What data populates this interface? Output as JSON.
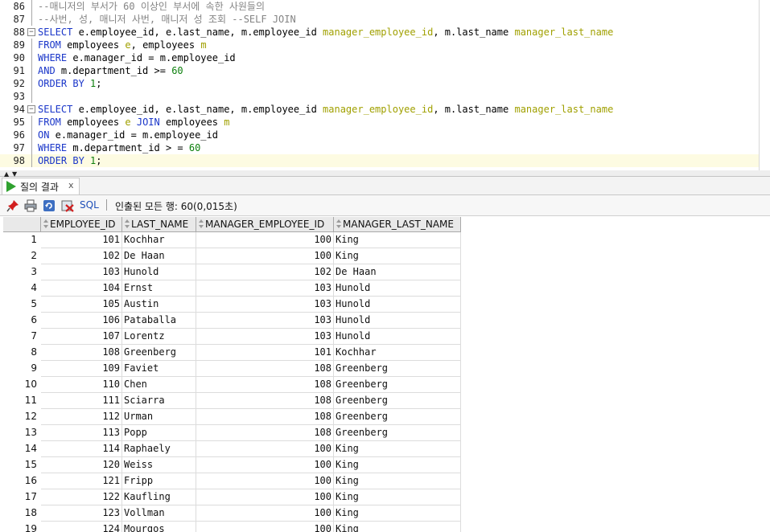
{
  "editor": {
    "lines": [
      {
        "num": "86",
        "tokens": [
          [
            "c",
            "--매니저의 부서가 60 이상인 부서에 속한 사원들의"
          ]
        ]
      },
      {
        "num": "87",
        "tokens": [
          [
            "c",
            "--사번, 성, 매니저 사번, 매니저 성 조회 --SELF JOIN"
          ]
        ]
      },
      {
        "num": "88",
        "tokens": [
          [
            "k",
            "SELECT"
          ],
          [
            "t",
            " e.employee_id, e.last_name, m.employee_id "
          ],
          [
            "a",
            "manager_employee_id"
          ],
          [
            "t",
            ", m.last_name "
          ],
          [
            "a",
            "manager_last_name"
          ]
        ]
      },
      {
        "num": "89",
        "tokens": [
          [
            "k",
            "FROM"
          ],
          [
            "t",
            " employees "
          ],
          [
            "a",
            "e"
          ],
          [
            "t",
            ", employees "
          ],
          [
            "a",
            "m"
          ]
        ]
      },
      {
        "num": "90",
        "tokens": [
          [
            "k",
            "WHERE"
          ],
          [
            "t",
            " e.manager_id = m.employee_id"
          ]
        ]
      },
      {
        "num": "91",
        "tokens": [
          [
            "k",
            "AND"
          ],
          [
            "t",
            " m.department_id >= "
          ],
          [
            "n",
            "60"
          ]
        ]
      },
      {
        "num": "92",
        "tokens": [
          [
            "k",
            "ORDER BY"
          ],
          [
            "t",
            " "
          ],
          [
            "n",
            "1"
          ],
          [
            "t",
            ";"
          ]
        ]
      },
      {
        "num": "93",
        "tokens": []
      },
      {
        "num": "94",
        "tokens": [
          [
            "k",
            "SELECT"
          ],
          [
            "t",
            " e.employee_id, e.last_name, m.employee_id "
          ],
          [
            "a",
            "manager_employee_id"
          ],
          [
            "t",
            ", m.last_name "
          ],
          [
            "a",
            "manager_last_name"
          ]
        ]
      },
      {
        "num": "95",
        "tokens": [
          [
            "k",
            "FROM"
          ],
          [
            "t",
            " employees "
          ],
          [
            "a",
            "e"
          ],
          [
            "t",
            " "
          ],
          [
            "k",
            "JOIN"
          ],
          [
            "t",
            " employees "
          ],
          [
            "a",
            "m"
          ]
        ]
      },
      {
        "num": "96",
        "tokens": [
          [
            "k",
            "ON"
          ],
          [
            "t",
            " e.manager_id = m.employee_id"
          ]
        ]
      },
      {
        "num": "97",
        "tokens": [
          [
            "k",
            "WHERE"
          ],
          [
            "t",
            " m.department_id > = "
          ],
          [
            "n",
            "60"
          ]
        ]
      },
      {
        "num": "98",
        "tokens": [
          [
            "k",
            "ORDER BY"
          ],
          [
            "t",
            " "
          ],
          [
            "n",
            "1"
          ],
          [
            "t",
            ";"
          ]
        ]
      }
    ],
    "fold_lines": [
      "88",
      "94"
    ],
    "current_line": "98"
  },
  "results_tab": {
    "label": "질의 결과",
    "close": "x"
  },
  "toolbar": {
    "sql_label": "SQL",
    "status": "인출된 모든 행: 60(0,015초)"
  },
  "grid": {
    "columns": [
      "EMPLOYEE_ID",
      "LAST_NAME",
      "MANAGER_EMPLOYEE_ID",
      "MANAGER_LAST_NAME"
    ],
    "rows": [
      [
        "1",
        "101",
        "Kochhar",
        "100",
        "King"
      ],
      [
        "2",
        "102",
        "De Haan",
        "100",
        "King"
      ],
      [
        "3",
        "103",
        "Hunold",
        "102",
        "De Haan"
      ],
      [
        "4",
        "104",
        "Ernst",
        "103",
        "Hunold"
      ],
      [
        "5",
        "105",
        "Austin",
        "103",
        "Hunold"
      ],
      [
        "6",
        "106",
        "Pataballa",
        "103",
        "Hunold"
      ],
      [
        "7",
        "107",
        "Lorentz",
        "103",
        "Hunold"
      ],
      [
        "8",
        "108",
        "Greenberg",
        "101",
        "Kochhar"
      ],
      [
        "9",
        "109",
        "Faviet",
        "108",
        "Greenberg"
      ],
      [
        "10",
        "110",
        "Chen",
        "108",
        "Greenberg"
      ],
      [
        "11",
        "111",
        "Sciarra",
        "108",
        "Greenberg"
      ],
      [
        "12",
        "112",
        "Urman",
        "108",
        "Greenberg"
      ],
      [
        "13",
        "113",
        "Popp",
        "108",
        "Greenberg"
      ],
      [
        "14",
        "114",
        "Raphaely",
        "100",
        "King"
      ],
      [
        "15",
        "120",
        "Weiss",
        "100",
        "King"
      ],
      [
        "16",
        "121",
        "Fripp",
        "100",
        "King"
      ],
      [
        "17",
        "122",
        "Kaufling",
        "100",
        "King"
      ],
      [
        "18",
        "123",
        "Vollman",
        "100",
        "King"
      ],
      [
        "19",
        "124",
        "Mourgos",
        "100",
        "King"
      ]
    ]
  },
  "colors": {
    "keyword": "#1a36c9",
    "comment": "#848484",
    "alias": "#a0a000",
    "number": "#0c7f0c",
    "current_line": "#fdfbe2",
    "run_green": "#2fa12f"
  }
}
